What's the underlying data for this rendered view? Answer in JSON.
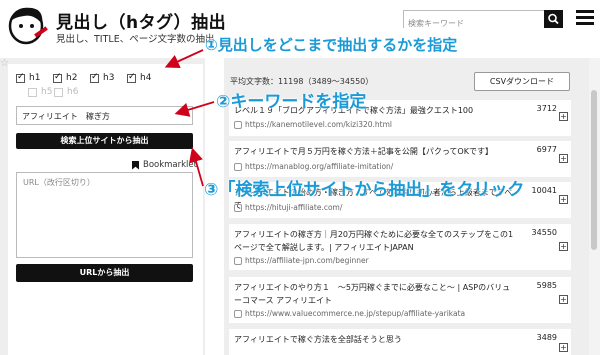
{
  "header": {
    "title": "見出し（hタグ）抽出",
    "subtitle": "見出し、TITLE、ページ文字数の抽出",
    "search_placeholder": "検索キーワード"
  },
  "options": {
    "headings": [
      {
        "label": "h1",
        "checked": true,
        "enabled": true
      },
      {
        "label": "h2",
        "checked": true,
        "enabled": true
      },
      {
        "label": "h3",
        "checked": true,
        "enabled": true
      },
      {
        "label": "h4",
        "checked": true,
        "enabled": true
      },
      {
        "label": "h5",
        "checked": false,
        "enabled": false
      },
      {
        "label": "h6",
        "checked": false,
        "enabled": false
      }
    ],
    "keyword_value": "アフィリエイト　稼ぎ方",
    "search_extract_button": "検索上位サイトから抽出",
    "bookmarklet": "Bookmarklet",
    "url_placeholder": "URL（改行区切り）",
    "url_extract_button": "URLから抽出"
  },
  "results": {
    "summary": "平均文字数：11198（3489〜34550）",
    "csv_button": "CSVダウンロード",
    "items": [
      {
        "title": "レベル１９「ブログアフィリエイトで稼ぐ方法」最強クエスト100",
        "count": "3712",
        "url": "https://kanemotilevel.com/kizi320.html"
      },
      {
        "title": "アフィリエイトで月５万円を稼ぐ方法＋記事を公開【パクってOKです】",
        "count": "6977",
        "url": "https://manablog.org/affiliate-imitation/"
      },
      {
        "title": "アフィリエイトの始め方・稼ぎ方・すべてを解説！初心者から上級者まですべて",
        "count": "10041",
        "url": "https://hituji-affiliate.com/"
      },
      {
        "title": "アフィリエイトの稼ぎ方｜月20万円稼ぐために必要な全てのステップをこの1ページで全て解説します。| アフィリエイトJAPAN",
        "count": "34550",
        "url": "https://affiliate-jpn.com/beginner"
      },
      {
        "title": "アフィリエイトのやり方１　〜5万円稼ぐまでに必要なこと〜 | ASPのバリューコマース アフィリエイト",
        "count": "5985",
        "url": "https://www.valuecommerce.ne.jp/stepup/affiliate-yarikata"
      },
      {
        "title": "アフィリエイトで稼ぐ方法を全部話そうと思う",
        "count": "3489",
        "url": ""
      }
    ]
  },
  "annotations": {
    "step1": "①見出しをどこまで抽出するかを指定",
    "step2": "②キーワードを指定",
    "step3": "③「検索上位サイトから抽出」をクリック"
  },
  "colors": {
    "annotation": "#1a9ad6",
    "arrow": "#d0021b",
    "button": "#111111"
  }
}
